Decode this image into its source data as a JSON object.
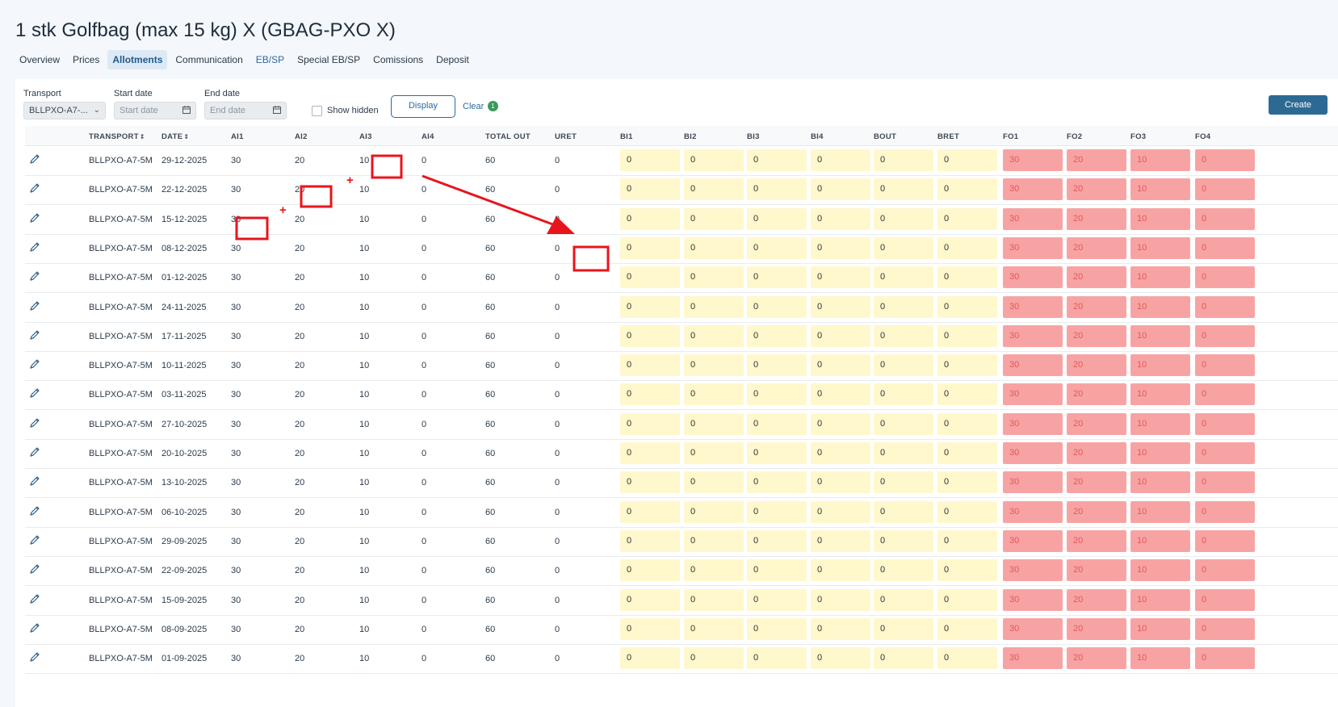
{
  "page": {
    "title": "1 stk Golfbag (max 15 kg) X (GBAG-PXO X)"
  },
  "tabs": [
    {
      "label": "Overview",
      "style": "normal"
    },
    {
      "label": "Prices",
      "style": "normal"
    },
    {
      "label": "Allotments",
      "style": "active"
    },
    {
      "label": "Communication",
      "style": "normal"
    },
    {
      "label": "EB/SP",
      "style": "blue"
    },
    {
      "label": "Special EB/SP",
      "style": "normal"
    },
    {
      "label": "Comissions",
      "style": "normal"
    },
    {
      "label": "Deposit",
      "style": "normal"
    }
  ],
  "filters": {
    "transport_label": "Transport",
    "transport_value": "BLLPXO-A7-...",
    "start_label": "Start date",
    "start_placeholder": "Start date",
    "end_label": "End date",
    "end_placeholder": "End date",
    "show_hidden_label": "Show hidden",
    "display_label": "Display",
    "clear_label": "Clear",
    "clear_count": "1",
    "create_label": "Create"
  },
  "columns": [
    "TRANSPORT",
    "DATE",
    "AI1",
    "AI2",
    "AI3",
    "AI4",
    "TOTAL OUT",
    "URET",
    "BI1",
    "BI2",
    "BI3",
    "BI4",
    "BOUT",
    "BRET",
    "FO1",
    "FO2",
    "FO3",
    "FO4"
  ],
  "sortable_suffix": "⇕",
  "rows": [
    {
      "transport": "BLLPXO-A7-5M",
      "date": "29-12-2025",
      "ai1": "30",
      "ai2": "20",
      "ai3": "10",
      "ai4": "0",
      "total_out": "60",
      "uret": "0",
      "bi1": "0",
      "bi2": "0",
      "bi3": "0",
      "bi4": "0",
      "bout": "0",
      "bret": "0",
      "fo1": "30",
      "fo2": "20",
      "fo3": "10",
      "fo4": "0"
    },
    {
      "transport": "BLLPXO-A7-5M",
      "date": "22-12-2025",
      "ai1": "30",
      "ai2": "20",
      "ai3": "10",
      "ai4": "0",
      "total_out": "60",
      "uret": "0",
      "bi1": "0",
      "bi2": "0",
      "bi3": "0",
      "bi4": "0",
      "bout": "0",
      "bret": "0",
      "fo1": "30",
      "fo2": "20",
      "fo3": "10",
      "fo4": "0"
    },
    {
      "transport": "BLLPXO-A7-5M",
      "date": "15-12-2025",
      "ai1": "30",
      "ai2": "20",
      "ai3": "10",
      "ai4": "0",
      "total_out": "60",
      "uret": "0",
      "bi1": "0",
      "bi2": "0",
      "bi3": "0",
      "bi4": "0",
      "bout": "0",
      "bret": "0",
      "fo1": "30",
      "fo2": "20",
      "fo3": "10",
      "fo4": "0"
    },
    {
      "transport": "BLLPXO-A7-5M",
      "date": "08-12-2025",
      "ai1": "30",
      "ai2": "20",
      "ai3": "10",
      "ai4": "0",
      "total_out": "60",
      "uret": "0",
      "bi1": "0",
      "bi2": "0",
      "bi3": "0",
      "bi4": "0",
      "bout": "0",
      "bret": "0",
      "fo1": "30",
      "fo2": "20",
      "fo3": "10",
      "fo4": "0"
    },
    {
      "transport": "BLLPXO-A7-5M",
      "date": "01-12-2025",
      "ai1": "30",
      "ai2": "20",
      "ai3": "10",
      "ai4": "0",
      "total_out": "60",
      "uret": "0",
      "bi1": "0",
      "bi2": "0",
      "bi3": "0",
      "bi4": "0",
      "bout": "0",
      "bret": "0",
      "fo1": "30",
      "fo2": "20",
      "fo3": "10",
      "fo4": "0"
    },
    {
      "transport": "BLLPXO-A7-5M",
      "date": "24-11-2025",
      "ai1": "30",
      "ai2": "20",
      "ai3": "10",
      "ai4": "0",
      "total_out": "60",
      "uret": "0",
      "bi1": "0",
      "bi2": "0",
      "bi3": "0",
      "bi4": "0",
      "bout": "0",
      "bret": "0",
      "fo1": "30",
      "fo2": "20",
      "fo3": "10",
      "fo4": "0"
    },
    {
      "transport": "BLLPXO-A7-5M",
      "date": "17-11-2025",
      "ai1": "30",
      "ai2": "20",
      "ai3": "10",
      "ai4": "0",
      "total_out": "60",
      "uret": "0",
      "bi1": "0",
      "bi2": "0",
      "bi3": "0",
      "bi4": "0",
      "bout": "0",
      "bret": "0",
      "fo1": "30",
      "fo2": "20",
      "fo3": "10",
      "fo4": "0"
    },
    {
      "transport": "BLLPXO-A7-5M",
      "date": "10-11-2025",
      "ai1": "30",
      "ai2": "20",
      "ai3": "10",
      "ai4": "0",
      "total_out": "60",
      "uret": "0",
      "bi1": "0",
      "bi2": "0",
      "bi3": "0",
      "bi4": "0",
      "bout": "0",
      "bret": "0",
      "fo1": "30",
      "fo2": "20",
      "fo3": "10",
      "fo4": "0"
    },
    {
      "transport": "BLLPXO-A7-5M",
      "date": "03-11-2025",
      "ai1": "30",
      "ai2": "20",
      "ai3": "10",
      "ai4": "0",
      "total_out": "60",
      "uret": "0",
      "bi1": "0",
      "bi2": "0",
      "bi3": "0",
      "bi4": "0",
      "bout": "0",
      "bret": "0",
      "fo1": "30",
      "fo2": "20",
      "fo3": "10",
      "fo4": "0"
    },
    {
      "transport": "BLLPXO-A7-5M",
      "date": "27-10-2025",
      "ai1": "30",
      "ai2": "20",
      "ai3": "10",
      "ai4": "0",
      "total_out": "60",
      "uret": "0",
      "bi1": "0",
      "bi2": "0",
      "bi3": "0",
      "bi4": "0",
      "bout": "0",
      "bret": "0",
      "fo1": "30",
      "fo2": "20",
      "fo3": "10",
      "fo4": "0"
    },
    {
      "transport": "BLLPXO-A7-5M",
      "date": "20-10-2025",
      "ai1": "30",
      "ai2": "20",
      "ai3": "10",
      "ai4": "0",
      "total_out": "60",
      "uret": "0",
      "bi1": "0",
      "bi2": "0",
      "bi3": "0",
      "bi4": "0",
      "bout": "0",
      "bret": "0",
      "fo1": "30",
      "fo2": "20",
      "fo3": "10",
      "fo4": "0"
    },
    {
      "transport": "BLLPXO-A7-5M",
      "date": "13-10-2025",
      "ai1": "30",
      "ai2": "20",
      "ai3": "10",
      "ai4": "0",
      "total_out": "60",
      "uret": "0",
      "bi1": "0",
      "bi2": "0",
      "bi3": "0",
      "bi4": "0",
      "bout": "0",
      "bret": "0",
      "fo1": "30",
      "fo2": "20",
      "fo3": "10",
      "fo4": "0"
    },
    {
      "transport": "BLLPXO-A7-5M",
      "date": "06-10-2025",
      "ai1": "30",
      "ai2": "20",
      "ai3": "10",
      "ai4": "0",
      "total_out": "60",
      "uret": "0",
      "bi1": "0",
      "bi2": "0",
      "bi3": "0",
      "bi4": "0",
      "bout": "0",
      "bret": "0",
      "fo1": "30",
      "fo2": "20",
      "fo3": "10",
      "fo4": "0"
    },
    {
      "transport": "BLLPXO-A7-5M",
      "date": "29-09-2025",
      "ai1": "30",
      "ai2": "20",
      "ai3": "10",
      "ai4": "0",
      "total_out": "60",
      "uret": "0",
      "bi1": "0",
      "bi2": "0",
      "bi3": "0",
      "bi4": "0",
      "bout": "0",
      "bret": "0",
      "fo1": "30",
      "fo2": "20",
      "fo3": "10",
      "fo4": "0"
    },
    {
      "transport": "BLLPXO-A7-5M",
      "date": "22-09-2025",
      "ai1": "30",
      "ai2": "20",
      "ai3": "10",
      "ai4": "0",
      "total_out": "60",
      "uret": "0",
      "bi1": "0",
      "bi2": "0",
      "bi3": "0",
      "bi4": "0",
      "bout": "0",
      "bret": "0",
      "fo1": "30",
      "fo2": "20",
      "fo3": "10",
      "fo4": "0"
    },
    {
      "transport": "BLLPXO-A7-5M",
      "date": "15-09-2025",
      "ai1": "30",
      "ai2": "20",
      "ai3": "10",
      "ai4": "0",
      "total_out": "60",
      "uret": "0",
      "bi1": "0",
      "bi2": "0",
      "bi3": "0",
      "bi4": "0",
      "bout": "0",
      "bret": "0",
      "fo1": "30",
      "fo2": "20",
      "fo3": "10",
      "fo4": "0"
    },
    {
      "transport": "BLLPXO-A7-5M",
      "date": "08-09-2025",
      "ai1": "30",
      "ai2": "20",
      "ai3": "10",
      "ai4": "0",
      "total_out": "60",
      "uret": "0",
      "bi1": "0",
      "bi2": "0",
      "bi3": "0",
      "bi4": "0",
      "bout": "0",
      "bret": "0",
      "fo1": "30",
      "fo2": "20",
      "fo3": "10",
      "fo4": "0"
    },
    {
      "transport": "BLLPXO-A7-5M",
      "date": "01-09-2025",
      "ai1": "30",
      "ai2": "20",
      "ai3": "10",
      "ai4": "0",
      "total_out": "60",
      "uret": "0",
      "bi1": "0",
      "bi2": "0",
      "bi3": "0",
      "bi4": "0",
      "bout": "0",
      "bret": "0",
      "fo1": "30",
      "fo2": "20",
      "fo3": "10",
      "fo4": "0"
    }
  ],
  "annotations": {
    "plus_sign": "+",
    "color": "#e8141c"
  },
  "icons": {
    "edit": "pencil-icon",
    "calendar": "calendar-icon",
    "dropdown": "chevron-down-icon"
  },
  "colors": {
    "accent": "#2d6aa0",
    "create_button": "#2d6a93",
    "yellow_cell": "#fef8cc",
    "red_cell": "#f8a3a3",
    "annotation": "#e8141c"
  }
}
